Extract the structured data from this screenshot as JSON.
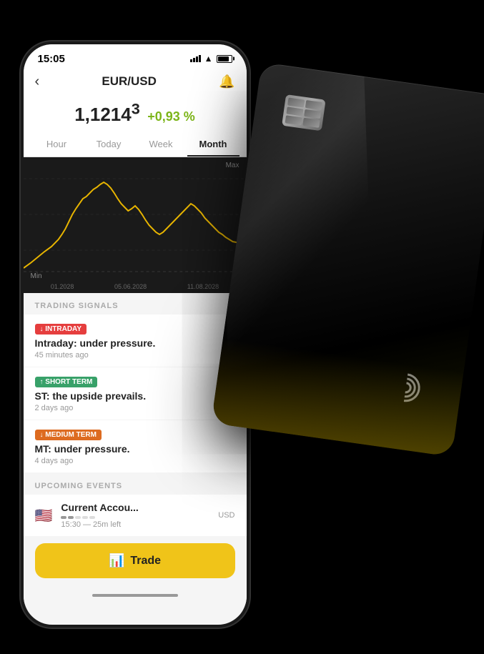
{
  "status": {
    "time": "15:05"
  },
  "header": {
    "pair": "EUR/USD",
    "back_label": "‹",
    "notif_icon": "🔔"
  },
  "price": {
    "value": "1,1214",
    "superscript": "3",
    "change": "+0,93 %"
  },
  "tabs": [
    {
      "label": "Hour",
      "active": false
    },
    {
      "label": "Today",
      "active": false
    },
    {
      "label": "Week",
      "active": false
    },
    {
      "label": "Month",
      "active": true
    }
  ],
  "chart": {
    "max_label": "Max",
    "min_label": "Min",
    "dates": [
      "01.2028",
      "05.06.2028",
      "11.08.2028"
    ]
  },
  "trading_signals": {
    "section_title": "TRADING SIGNALS",
    "items": [
      {
        "badge": "↓ INTRADAY",
        "badge_type": "red",
        "text": "Intraday: under pressure.",
        "time": "45 minutes ago"
      },
      {
        "badge": "↑ SHORT TERM",
        "badge_type": "green",
        "text": "ST: the upside prevails.",
        "time": "2 days ago"
      },
      {
        "badge": "↓ MEDIUM TERM",
        "badge_type": "orange",
        "text": "MT: under pressure.",
        "time": "4 days ago"
      }
    ]
  },
  "upcoming_events": {
    "section_title": "UPCOMING EVENTS",
    "items": [
      {
        "flag": "🇺🇸",
        "name": "Current Accou...",
        "time": "15:30 — 25m left",
        "currency": "USD"
      }
    ]
  },
  "trade_button": {
    "label": "Trade",
    "icon": "📊"
  }
}
